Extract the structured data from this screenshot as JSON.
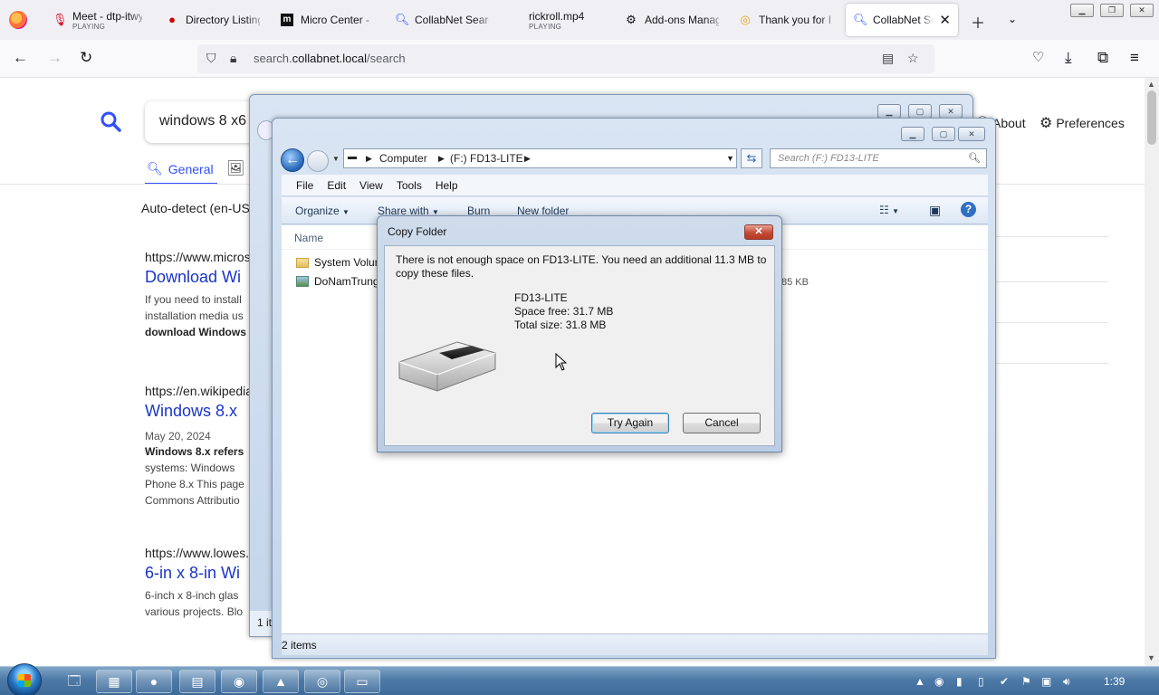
{
  "browser": {
    "tabs": [
      {
        "title": "Meet - dtp-itwy",
        "sub": "PLAYING",
        "icon": "mic-icon"
      },
      {
        "title": "Directory Listing",
        "icon": "redhat-icon"
      },
      {
        "title": "Micro Center - I",
        "icon": "microcenter-icon"
      },
      {
        "title": "CollabNet Search",
        "icon": "search-icon"
      },
      {
        "title": "rickroll.mp4",
        "sub": "PLAYING",
        "icon": "media-icon"
      },
      {
        "title": "Add-ons Manager",
        "icon": "puzzle-icon"
      },
      {
        "title": "Thank you for I",
        "icon": "addon-icon"
      },
      {
        "title": "CollabNet Se",
        "icon": "search-icon",
        "active": true
      }
    ],
    "url_prefix": "search.",
    "url_domain": "collabnet.local",
    "url_path": "/search"
  },
  "search_page": {
    "query": "windows 8 x6",
    "tab_general": "General",
    "about_label": "About",
    "preferences_label": "Preferences",
    "autodetect": "Auto-detect (en-US)",
    "results": [
      {
        "url": "https://www.micros",
        "title": "Download Wi",
        "snippet": [
          "If you need to install",
          "installation media us",
          "download Windows"
        ]
      },
      {
        "url": "https://en.wikipedia",
        "title": "Windows 8.x",
        "date": "May 20, 2024",
        "snippet": [
          "Windows 8.x refers",
          "systems: Windows",
          "Phone 8.x This page",
          "Commons Attributio"
        ]
      },
      {
        "url": "https://www.lowes.c",
        "title": "6-in x 8-in Wi",
        "snippet": [
          "6-inch x 8-inch glas",
          "various projects. Blo"
        ]
      }
    ]
  },
  "explorer_back": {
    "status": "1 it"
  },
  "explorer": {
    "breadcrumbs": [
      "Computer",
      "(F:) FD13-LITE"
    ],
    "search_placeholder": "Search (F:) FD13-LITE",
    "menu": [
      "File",
      "Edit",
      "View",
      "Tools",
      "Help"
    ],
    "commands": [
      "Organize",
      "Share with",
      "Burn",
      "New folder"
    ],
    "column_name": "Name",
    "files": [
      {
        "name": "System Volum",
        "size": ""
      },
      {
        "name": "DoNamTrung",
        "size": "85 KB"
      }
    ],
    "status": "2 items"
  },
  "dialog": {
    "title": "Copy Folder",
    "message": "There is not enough space on FD13-LITE. You need an additional 11.3 MB to copy these files.",
    "drive_name": "FD13-LITE",
    "space_free": "Space free: 31.7 MB",
    "total_size": "Total size: 31.8 MB",
    "try_again": "Try Again",
    "cancel": "Cancel"
  },
  "taskbar": {
    "clock": "1:39"
  },
  "colors": {
    "link_blue": "#1a35c9",
    "accent_blue": "#3050ff",
    "win7_taskbar": "#4d7aa7"
  }
}
